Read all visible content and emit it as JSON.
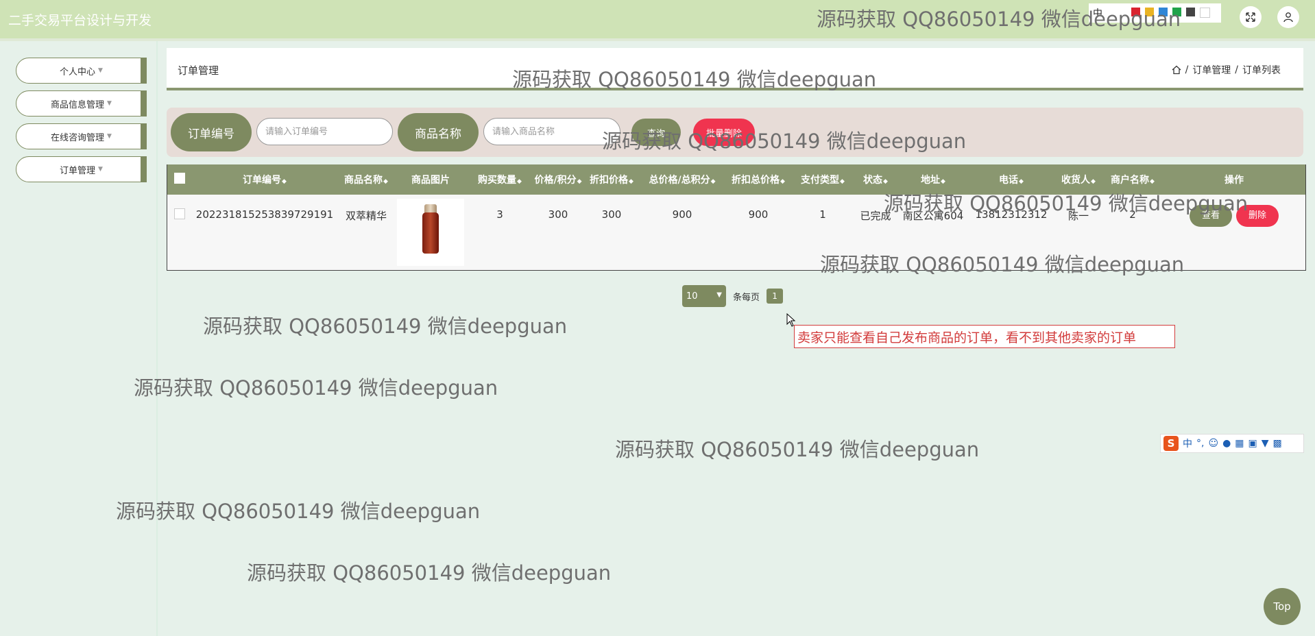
{
  "header": {
    "title": "二手交易平台设计与开发",
    "ime_indicator": "中",
    "swatch_colors": [
      "#d9242f",
      "#e9b323",
      "#2f86d6",
      "#20a34a",
      "#444444",
      "#ffffff"
    ]
  },
  "sidebar": {
    "items": [
      {
        "label": "个人中心"
      },
      {
        "label": "商品信息管理"
      },
      {
        "label": "在线咨询管理"
      },
      {
        "label": "订单管理"
      }
    ]
  },
  "breadcrumb": {
    "title": "订单管理",
    "path": [
      "订单管理",
      "订单列表"
    ],
    "sep": "/"
  },
  "search": {
    "order_no_label": "订单编号",
    "order_no_placeholder": "请输入订单编号",
    "product_name_label": "商品名称",
    "product_name_placeholder": "请输入商品名称",
    "query_label": "查询",
    "batch_delete_label": "批量删除"
  },
  "table": {
    "columns": [
      "订单编号",
      "商品名称",
      "商品图片",
      "购买数量",
      "价格/积分",
      "折扣价格",
      "总价格/总积分",
      "折扣总价格",
      "支付类型",
      "状态",
      "地址",
      "电话",
      "收货人",
      "商户名称",
      "操作"
    ],
    "rows": [
      {
        "order_no": "20223181525383972919​1",
        "product_name": "双萃精华",
        "quantity": "3",
        "price": "300",
        "discount_price": "300",
        "total_price": "900",
        "discount_total": "900",
        "pay_type": "1",
        "status": "已完成",
        "address": "南区公寓604",
        "phone": "13812312312",
        "receiver": "陈一",
        "merchant": "2",
        "view_label": "查看",
        "delete_label": "删除"
      }
    ]
  },
  "pagination": {
    "page_size": "10",
    "per_page_label": "条每页",
    "current_page": "1"
  },
  "annotation": "卖家只能查看自己发布商品的订单，看不到其他卖家的订单",
  "watermark_text": "源码获取 QQ86050149 微信deepguan",
  "ime_toolbar": {
    "logo": "S",
    "mode": "中",
    "punct": "°,"
  },
  "scroll_top_label": "Top"
}
